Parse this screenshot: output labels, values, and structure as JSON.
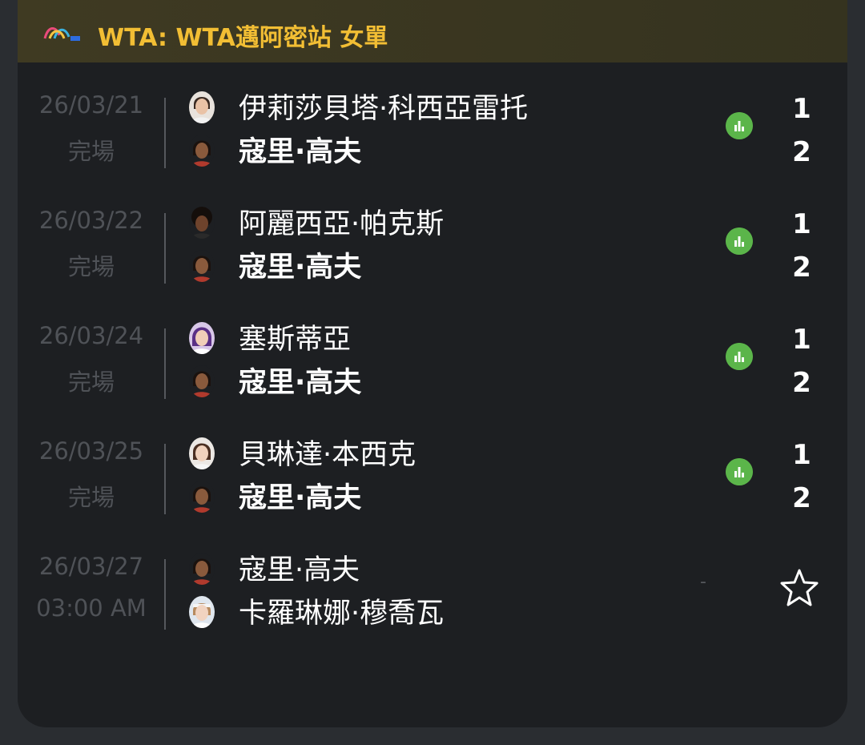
{
  "header": {
    "title": "WTA: WTA邁阿密站 女單",
    "logo_icon": "wta-logo-icon",
    "accent_color": "#f2be34"
  },
  "matches": [
    {
      "date": "26/03/21",
      "status": "完場",
      "player1": "伊莉莎貝塔·科西亞雷托",
      "player2": "寇里·高夫",
      "score1": "1",
      "score2": "2",
      "winner": 2
    },
    {
      "date": "26/03/22",
      "status": "完場",
      "player1": "阿麗西亞·帕克斯",
      "player2": "寇里·高夫",
      "score1": "1",
      "score2": "2",
      "winner": 2
    },
    {
      "date": "26/03/24",
      "status": "完場",
      "player1": "塞斯蒂亞",
      "player2": "寇里·高夫",
      "score1": "1",
      "score2": "2",
      "winner": 2
    },
    {
      "date": "26/03/25",
      "status": "完場",
      "player1": "貝琳達·本西克",
      "player2": "寇里·高夫",
      "score1": "1",
      "score2": "2",
      "winner": 2
    },
    {
      "date": "26/03/27",
      "status": "03:00 AM",
      "player1": "寇里·高夫",
      "player2": "卡羅琳娜·穆喬瓦",
      "placeholder": "-",
      "favorite_icon": "star-outline-icon"
    }
  ],
  "colors": {
    "stats_green": "#5bb54a",
    "muted_text": "#4f5257",
    "card_bg": "#1d1f22"
  }
}
